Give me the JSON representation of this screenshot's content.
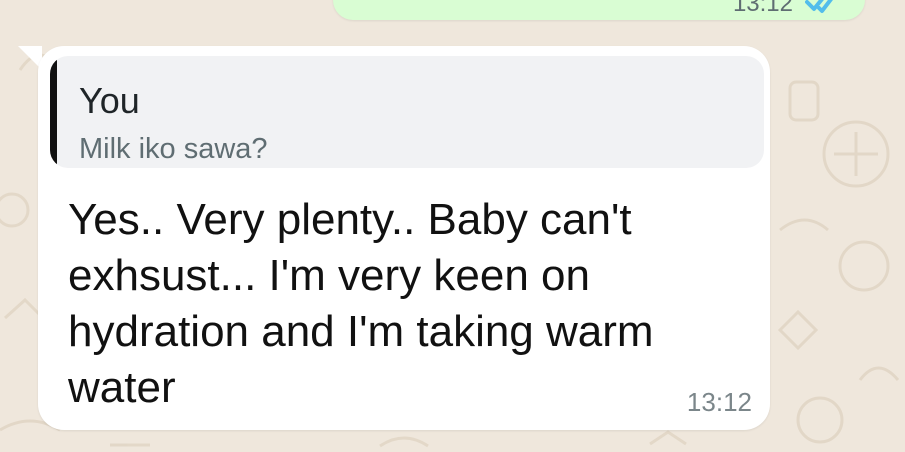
{
  "conversation": {
    "previous_message": {
      "time": "13:12",
      "status_icon": "double-check-read-icon"
    },
    "message": {
      "reply": {
        "author": "You",
        "text": "Milk iko sawa?"
      },
      "lines": [
        "Yes.. Very plenty.. Baby can't",
        "exhsust... I'm very keen on",
        "hydration and I'm taking warm",
        "water"
      ],
      "time": "13:12"
    }
  },
  "colors": {
    "background": "#efe7dc",
    "incoming_bubble": "#ffffff",
    "outgoing_bubble": "#d9fdd3",
    "read_ticks": "#53bdeb"
  }
}
